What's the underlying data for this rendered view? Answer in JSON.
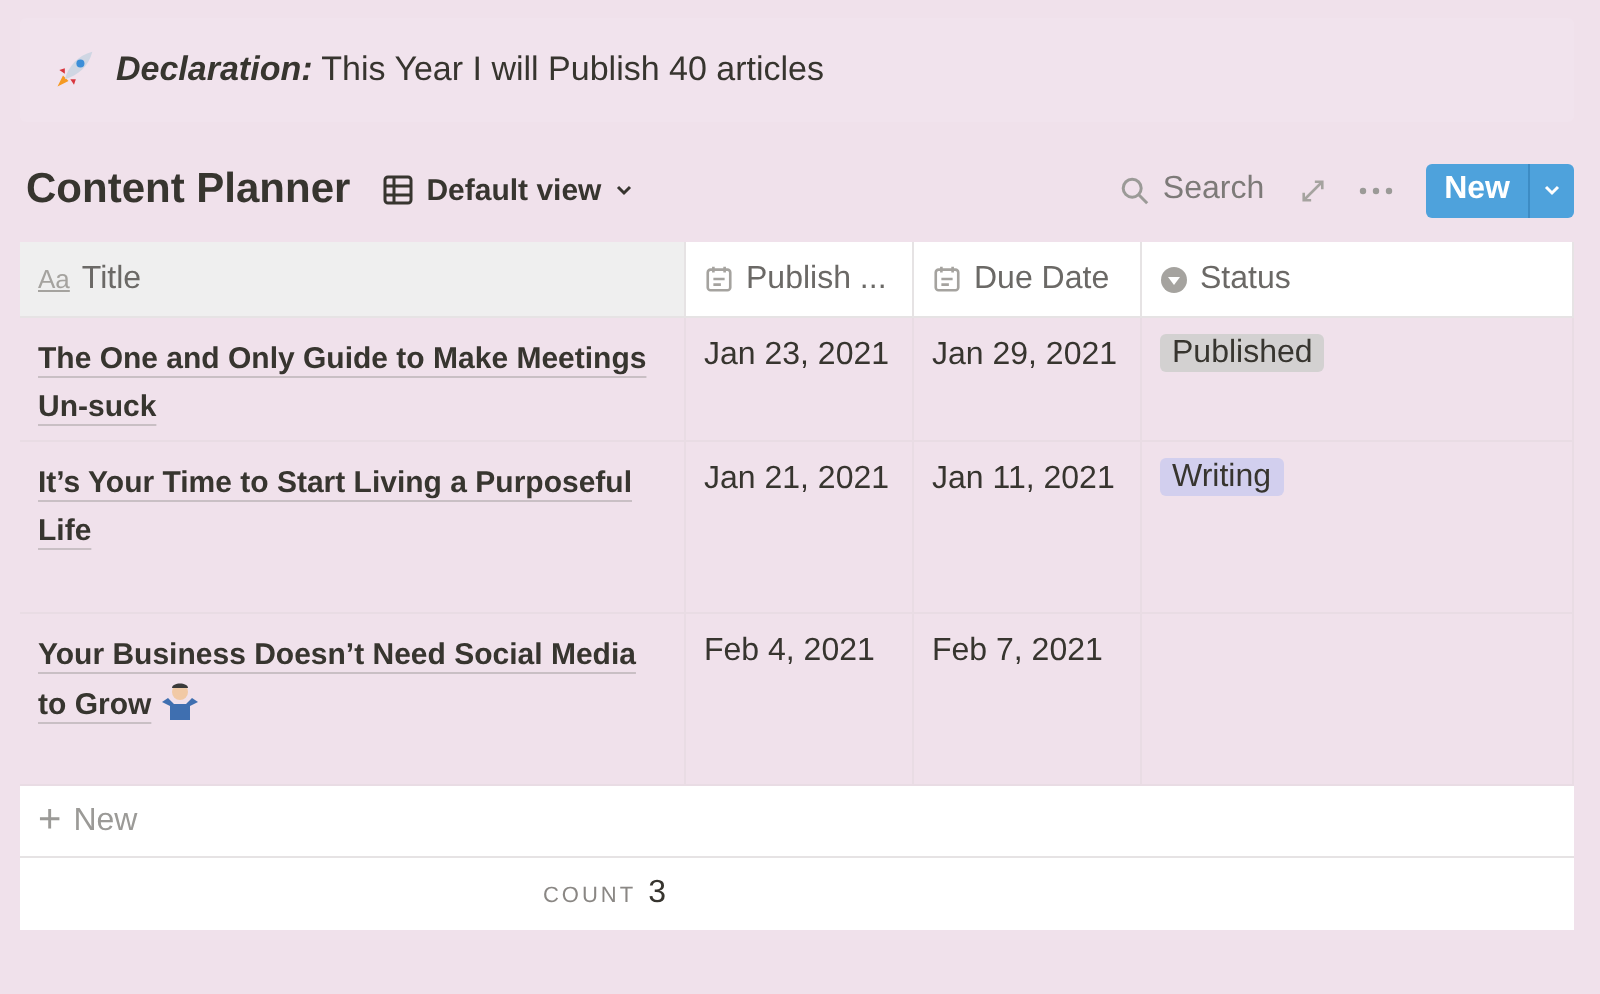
{
  "callout": {
    "label": "Declaration:",
    "text": "This Year I will Publish 40 articles"
  },
  "database": {
    "title": "Content Planner",
    "view": "Default view"
  },
  "toolbar": {
    "search": "Search",
    "new_button": "New"
  },
  "table": {
    "columns": [
      {
        "kind": "title",
        "label": "Title",
        "icon": "Aa"
      },
      {
        "kind": "date",
        "label": "Publish ..."
      },
      {
        "kind": "date",
        "label": "Due Date"
      },
      {
        "kind": "select",
        "label": "Status"
      }
    ],
    "rows": [
      {
        "title": "The One and Only Guide to Make Meetings Un-suck",
        "emoji": false,
        "publish": "Jan 23, 2021",
        "due": "Jan 29, 2021",
        "status": {
          "label": "Published",
          "color": "#d3d1d1"
        }
      },
      {
        "title": "It’s Your Time to Start Living a Purposeful Life",
        "emoji": false,
        "publish": "Jan 21, 2021",
        "due": "Jan 11, 2021",
        "status": {
          "label": "Writing",
          "color": "#d2cfee"
        }
      },
      {
        "title": "Your Business Doesn’t Need Social Media to Grow",
        "emoji": true,
        "publish": "Feb 4, 2021",
        "due": "Feb 7, 2021"
      }
    ],
    "add_row": {
      "icon": "+",
      "label": "New"
    },
    "footer": {
      "label": "COUNT",
      "value": "3"
    }
  }
}
